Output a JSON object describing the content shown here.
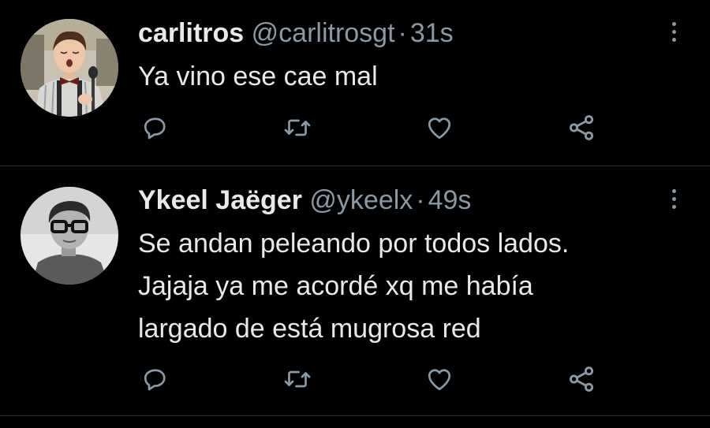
{
  "tweets": [
    {
      "display_name": "carlitros",
      "handle": "@carlitrosgt",
      "separator": "·",
      "time": "31s",
      "text_lines": [
        "Ya vino ese cae mal"
      ],
      "avatar_icon": "avatar-boy-singing"
    },
    {
      "display_name": "Ykeel Jaëger",
      "handle": "@ykeelx",
      "separator": "·",
      "time": "49s",
      "text_lines": [
        "Se andan peleando por todos lados.",
        "Jajaja ya me acordé xq me había",
        "largado de está mugrosa red"
      ],
      "avatar_icon": "avatar-glasses-bw"
    }
  ],
  "actions": {
    "reply_icon": "reply-icon",
    "retweet_icon": "retweet-icon",
    "like_icon": "heart-icon",
    "share_icon": "share-icon",
    "more_icon": "more-vertical-icon"
  },
  "colors": {
    "background": "#000000",
    "text": "#e7e9ea",
    "secondary": "#8b98a5",
    "divider": "#2a2d30"
  }
}
